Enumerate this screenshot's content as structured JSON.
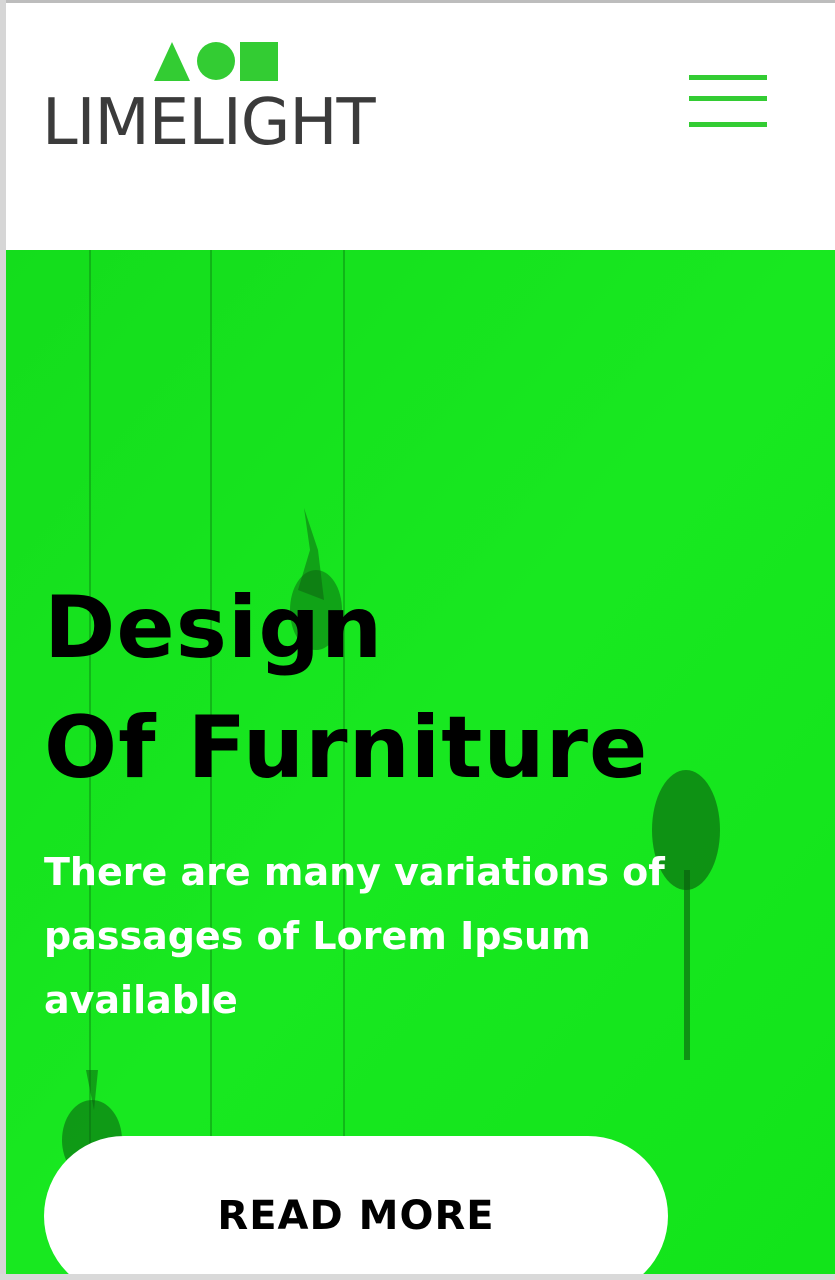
{
  "header": {
    "logo": {
      "text": "LIMELIGHT",
      "shapes": [
        "triangle",
        "circle",
        "square"
      ],
      "shape_color": "#33cc33",
      "text_color": "#3b3b3b"
    },
    "menu_icon": "hamburger-menu-icon",
    "accent_color": "#33cc33"
  },
  "hero": {
    "background_color": "#16e31e",
    "title_lines": [
      "Design",
      "Of Furniture"
    ],
    "subtitle_lines": [
      "There are many variations of",
      "passages of Lorem Ipsum",
      "available"
    ],
    "button_label": "READ MORE"
  }
}
